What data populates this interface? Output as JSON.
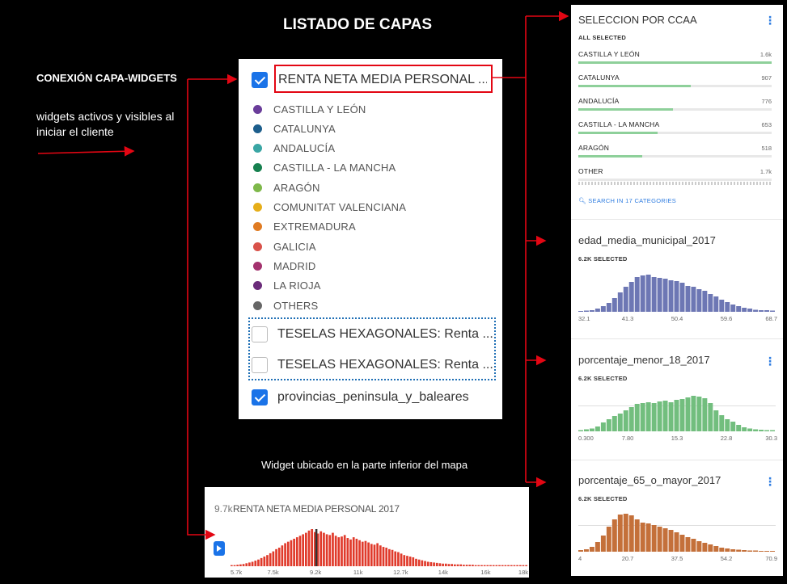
{
  "header": {
    "title": "LISTADO DE CAPAS"
  },
  "annotations": {
    "connection_title": "CONEXIÓN CAPA-WIDGETS",
    "connection_desc": "widgets activos y visibles al iniciar el cliente",
    "bottom_caption": "Widget ubicado en la parte inferior del mapa"
  },
  "layers": {
    "items": [
      {
        "label": "RENTA NETA MEDIA PERSONAL ...",
        "checked": true
      },
      {
        "label": "TESELAS HEXAGONALES: Renta ...",
        "checked": false
      },
      {
        "label": "TESELAS HEXAGONALES: Renta ...",
        "checked": false
      },
      {
        "label": "provincias_peninsula_y_baleares",
        "checked": true
      }
    ],
    "legend": [
      {
        "label": "CASTILLA Y LEÓN",
        "color": "#6a3d9a"
      },
      {
        "label": "CATALUNYA",
        "color": "#1d5e8c"
      },
      {
        "label": "ANDALUCÍA",
        "color": "#3aa6a4"
      },
      {
        "label": "CASTILLA - LA MANCHA",
        "color": "#16804f"
      },
      {
        "label": "ARAGÓN",
        "color": "#7eb84a"
      },
      {
        "label": "COMUNITAT VALENCIANA",
        "color": "#e6ae19"
      },
      {
        "label": "EXTREMADURA",
        "color": "#e07b22"
      },
      {
        "label": "GALICIA",
        "color": "#d9524a"
      },
      {
        "label": "MADRID",
        "color": "#a3326e"
      },
      {
        "label": "LA RIOJA",
        "color": "#6b2c7a"
      },
      {
        "label": "OTHERS",
        "color": "#666666"
      }
    ]
  },
  "widgets": {
    "category": {
      "title": "SELECCION POR CCAA",
      "subtitle": "ALL SELECTED",
      "rows": [
        {
          "name": "CASTILLA Y LEÓN",
          "value": "1.6k",
          "fraction": 1.0
        },
        {
          "name": "CATALUNYA",
          "value": "907",
          "fraction": 0.58
        },
        {
          "name": "ANDALUCÍA",
          "value": "776",
          "fraction": 0.49
        },
        {
          "name": "CASTILLA - LA MANCHA",
          "value": "653",
          "fraction": 0.41
        },
        {
          "name": "ARAGÓN",
          "value": "518",
          "fraction": 0.33
        },
        {
          "name": "OTHER",
          "value": "1.7k",
          "fraction": 0.0
        }
      ],
      "search_label": "SEARCH IN 17 CATEGORIES"
    },
    "histograms": [
      {
        "title": "edad_media_municipal_2017",
        "subtitle": "6.2K SELECTED",
        "color": "#6d77b4",
        "ticks": [
          "32.1",
          "41.3",
          "50.4",
          "59.6",
          "68.7"
        ],
        "bins": [
          0.02,
          0.03,
          0.04,
          0.08,
          0.14,
          0.22,
          0.34,
          0.48,
          0.62,
          0.74,
          0.86,
          0.9,
          0.92,
          0.86,
          0.84,
          0.82,
          0.78,
          0.76,
          0.72,
          0.64,
          0.62,
          0.56,
          0.52,
          0.44,
          0.38,
          0.3,
          0.24,
          0.18,
          0.14,
          0.1,
          0.08,
          0.05,
          0.04,
          0.04,
          0.03
        ]
      },
      {
        "title": "porcentaje_menor_18_2017",
        "subtitle": "6.2K SELECTED",
        "color": "#72be7e",
        "ticks": [
          "0.300",
          "7.80",
          "15.3",
          "22.8",
          "30.3"
        ],
        "bins": [
          0.03,
          0.05,
          0.07,
          0.12,
          0.22,
          0.3,
          0.38,
          0.44,
          0.52,
          0.6,
          0.68,
          0.7,
          0.72,
          0.7,
          0.74,
          0.76,
          0.72,
          0.78,
          0.8,
          0.84,
          0.88,
          0.86,
          0.82,
          0.7,
          0.52,
          0.4,
          0.3,
          0.24,
          0.16,
          0.1,
          0.07,
          0.05,
          0.04,
          0.03,
          0.03
        ]
      },
      {
        "title": "porcentaje_65_o_mayor_2017",
        "subtitle": "6.2K SELECTED",
        "color": "#c4703a",
        "ticks": [
          "4",
          "20.7",
          "37.5",
          "54.2",
          "70.9"
        ],
        "bins": [
          0.04,
          0.06,
          0.12,
          0.24,
          0.4,
          0.62,
          0.8,
          0.92,
          0.94,
          0.9,
          0.8,
          0.72,
          0.7,
          0.66,
          0.62,
          0.58,
          0.54,
          0.48,
          0.42,
          0.36,
          0.32,
          0.26,
          0.22,
          0.18,
          0.14,
          0.1,
          0.08,
          0.06,
          0.05,
          0.04,
          0.03,
          0.03,
          0.02,
          0.02,
          0.02
        ]
      }
    ],
    "bottom": {
      "count": "9.7k",
      "title": "RENTA NETA MEDIA PERSONAL 2017",
      "color": "#e03a2b",
      "ticks": [
        "5.7k",
        "7.5k",
        "9.2k",
        "11k",
        "12.7k",
        "14k",
        "16k",
        "18k"
      ],
      "bins": [
        0.03,
        0.03,
        0.04,
        0.05,
        0.06,
        0.08,
        0.1,
        0.12,
        0.15,
        0.18,
        0.22,
        0.26,
        0.3,
        0.35,
        0.4,
        0.46,
        0.5,
        0.56,
        0.62,
        0.66,
        0.7,
        0.74,
        0.78,
        0.82,
        0.86,
        0.9,
        0.96,
        1.0,
        0.92,
        0.88,
        0.94,
        0.9,
        0.86,
        0.84,
        0.9,
        0.82,
        0.78,
        0.8,
        0.84,
        0.76,
        0.72,
        0.78,
        0.74,
        0.7,
        0.66,
        0.68,
        0.64,
        0.6,
        0.58,
        0.62,
        0.56,
        0.52,
        0.5,
        0.46,
        0.44,
        0.4,
        0.38,
        0.34,
        0.3,
        0.28,
        0.26,
        0.24,
        0.2,
        0.18,
        0.16,
        0.14,
        0.12,
        0.11,
        0.1,
        0.09,
        0.08,
        0.07,
        0.07,
        0.06,
        0.06,
        0.05,
        0.05,
        0.05,
        0.04,
        0.04,
        0.04,
        0.04,
        0.03,
        0.03,
        0.03,
        0.03,
        0.03,
        0.03,
        0.03,
        0.03,
        0.03,
        0.03,
        0.03,
        0.03,
        0.03,
        0.03,
        0.03,
        0.03,
        0.03,
        0.03
      ],
      "marker_fraction": 0.285
    }
  }
}
